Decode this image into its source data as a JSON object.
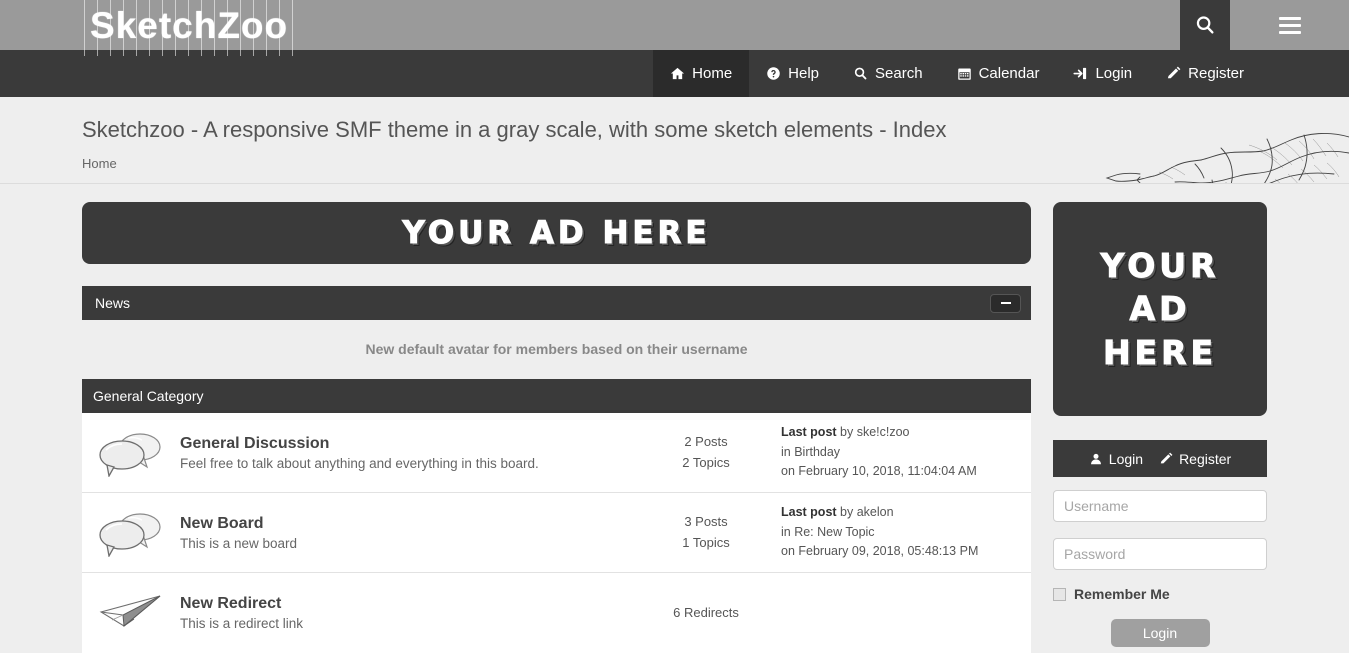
{
  "site": {
    "logo_text": "SketchZoo",
    "search_icon": "search-icon",
    "menu_icon": "hamburger-menu-icon"
  },
  "nav": {
    "items": [
      {
        "label": "Home",
        "icon": "home-icon",
        "active": true
      },
      {
        "label": "Help",
        "icon": "help-icon",
        "active": false
      },
      {
        "label": "Search",
        "icon": "search-icon",
        "active": false
      },
      {
        "label": "Calendar",
        "icon": "calendar-icon",
        "active": false
      },
      {
        "label": "Login",
        "icon": "login-icon",
        "active": false
      },
      {
        "label": "Register",
        "icon": "pencil-icon",
        "active": false
      }
    ]
  },
  "header": {
    "title": "Sketchzoo - A responsive SMF theme in a gray scale, with some sketch elements - Index",
    "breadcrumb": "Home",
    "decoration_icon": "hand-with-pencil-sketch"
  },
  "ads": {
    "banner_text": "YOUR AD HERE",
    "square_lines": [
      "YOUR",
      "AD",
      "HERE"
    ]
  },
  "news": {
    "title": "News",
    "collapse_icon": "minus-icon",
    "message": "New default avatar for members based on their username"
  },
  "category": {
    "title": "General Category",
    "boards": [
      {
        "name": "General Discussion",
        "description": "Feel free to talk about anything and everything in this board.",
        "icon": "speech-bubbles-icon",
        "posts": "2 Posts",
        "topics": "2 Topics",
        "last_post_label": "Last post",
        "last_post_by": " by ske!c!zoo",
        "last_post_in": "in Birthday",
        "last_post_on": "on February 10, 2018, 11:04:04 AM"
      },
      {
        "name": "New Board",
        "description": "This is a new board",
        "icon": "speech-bubbles-icon",
        "posts": "3 Posts",
        "topics": "1 Topics",
        "last_post_label": "Last post",
        "last_post_by": " by akelon",
        "last_post_in": "in Re: New Topic",
        "last_post_on": "on February 09, 2018, 05:48:13 PM"
      },
      {
        "name": "New Redirect",
        "description": "This is a redirect link",
        "icon": "paper-plane-icon",
        "posts": "6 Redirects",
        "topics": "",
        "last_post_label": "",
        "last_post_by": "",
        "last_post_in": "",
        "last_post_on": ""
      }
    ]
  },
  "login_panel": {
    "login_label": "Login",
    "login_icon": "user-icon",
    "register_label": "Register",
    "register_icon": "pencil-icon",
    "username_placeholder": "Username",
    "username_value": "",
    "password_placeholder": "Password",
    "password_value": "",
    "remember_label": "Remember Me",
    "remember_checked": false,
    "submit_label": "Login"
  },
  "colors": {
    "topbar_gray": "#9a9a9a",
    "dark": "#3a3a3a",
    "dark_active": "#2b2b2b",
    "page_bg": "#eeeeee",
    "panel_bg": "#ffffff",
    "button_gray": "#a0a0a0"
  }
}
